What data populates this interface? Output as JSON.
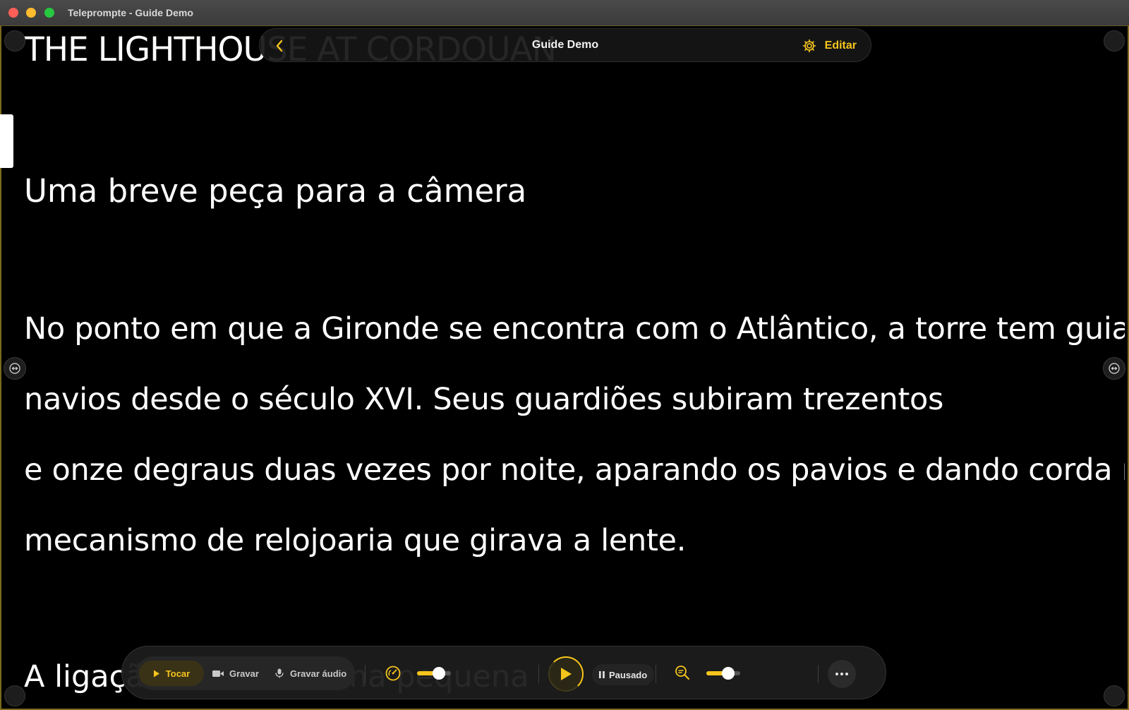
{
  "window": {
    "title": "Teleprompte - Guide Demo"
  },
  "header": {
    "doc_title": "Guide Demo",
    "edit_label": "Editar"
  },
  "script": {
    "title": "THE LIGHTHOUSE AT CORDOUAN",
    "subtitle": "Uma breve peça para a câmera",
    "lines": [
      "No ponto em que a Gironde se encontra com o Atlântico, a torre tem guiado",
      "navios desde o século XVI. Seus guardiões subiram trezentos",
      "e onze degraus duas vezes por noite, aparando os pavios e dando corda no",
      "mecanismo de relojoaria que girava a lente."
    ],
    "next_line": "A ligação real. . .ra uma pequena"
  },
  "controls": {
    "mode_play": "Tocar",
    "mode_record": "Gravar",
    "mode_audio": "Gravar áudio",
    "status": "Pausado",
    "speed_level": 0.65,
    "zoom_level": 0.65
  },
  "colors": {
    "accent": "#f5c51c",
    "background": "#000000"
  }
}
